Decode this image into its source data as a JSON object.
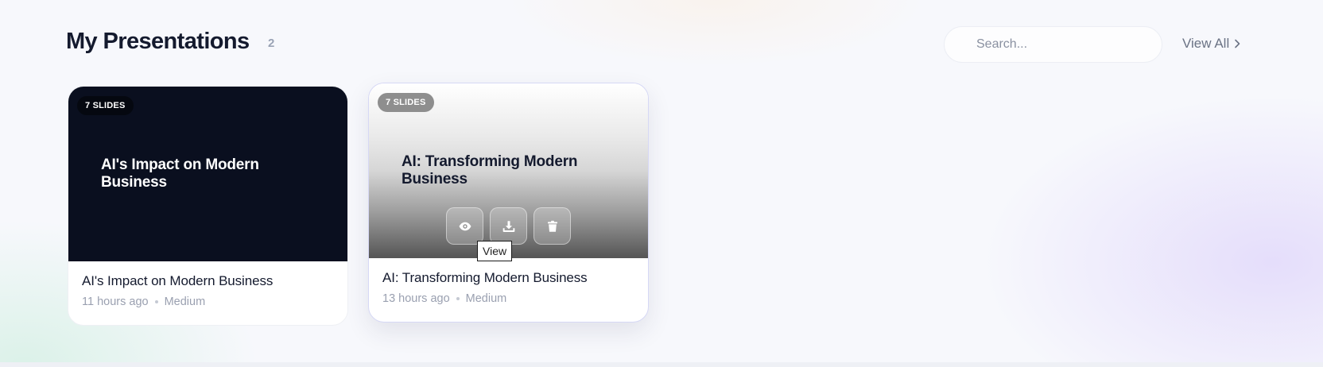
{
  "header": {
    "title": "My Presentations",
    "count": "2",
    "search_placeholder": "Search...",
    "view_all_label": "View All"
  },
  "presentations": [
    {
      "slides_badge": "7 SLIDES",
      "thumb_title": "AI's Impact on Modern Business",
      "name": "AI's Impact on Modern Business",
      "time": "11 hours ago",
      "level": "Medium"
    },
    {
      "slides_badge": "7 SLIDES",
      "thumb_title": "AI: Transforming Modern Business",
      "name": "AI: Transforming Modern Business",
      "time": "13 hours ago",
      "level": "Medium",
      "actions": [
        {
          "icon": "eye-icon",
          "label": "View"
        },
        {
          "icon": "download-icon",
          "label": "Download"
        },
        {
          "icon": "trash-icon",
          "label": "Delete"
        }
      ],
      "tooltip": "View"
    }
  ],
  "colors": {
    "title": "#141a2e",
    "dark_thumb": "#0a0f1f",
    "muted": "#9aa0b0"
  }
}
